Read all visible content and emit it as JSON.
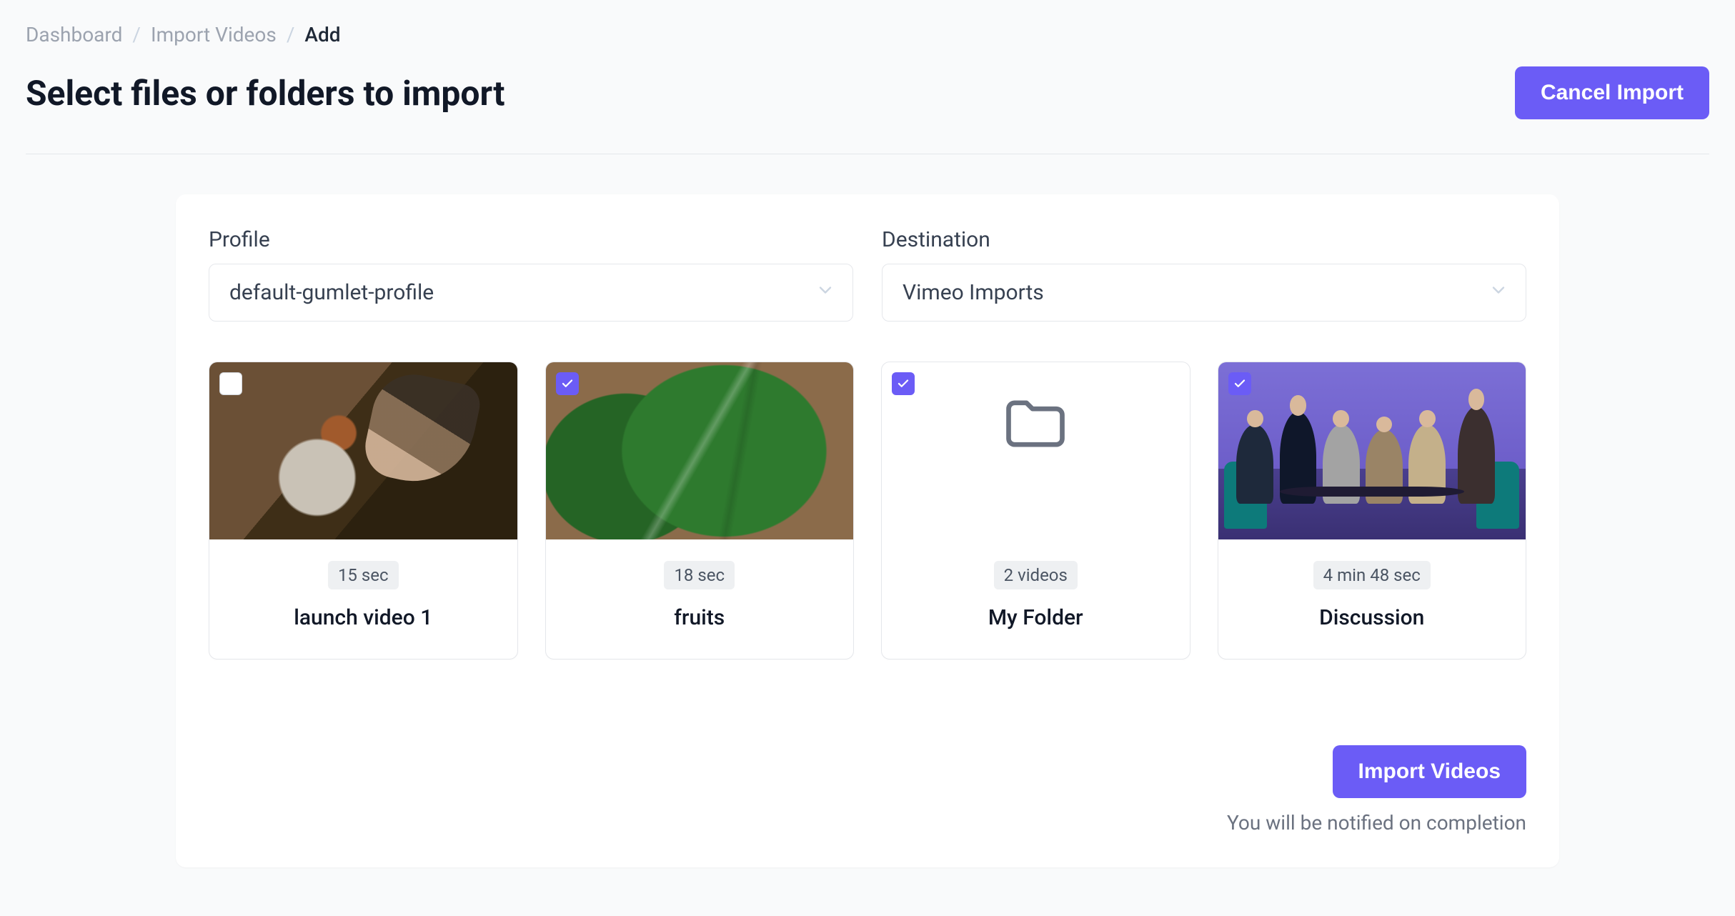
{
  "breadcrumb": {
    "items": [
      {
        "label": "Dashboard",
        "active": false
      },
      {
        "label": "Import Videos",
        "active": false
      },
      {
        "label": "Add",
        "active": true
      }
    ]
  },
  "page": {
    "title": "Select files or folders to import",
    "cancel_label": "Cancel Import"
  },
  "form": {
    "profile": {
      "label": "Profile",
      "value": "default-gumlet-profile"
    },
    "destination": {
      "label": "Destination",
      "value": "Vimeo Imports"
    }
  },
  "items": [
    {
      "title": "launch video 1",
      "meta": "15 sec",
      "selected": false,
      "type": "video",
      "thumb": "squirrel"
    },
    {
      "title": "fruits",
      "meta": "18 sec",
      "selected": true,
      "type": "video",
      "thumb": "leaves"
    },
    {
      "title": "My Folder",
      "meta": "2 videos",
      "selected": true,
      "type": "folder",
      "thumb": "folder"
    },
    {
      "title": "Discussion",
      "meta": "4 min 48 sec",
      "selected": true,
      "type": "video",
      "thumb": "discussion"
    }
  ],
  "footer": {
    "import_label": "Import Videos",
    "note": "You will be notified on completion"
  }
}
